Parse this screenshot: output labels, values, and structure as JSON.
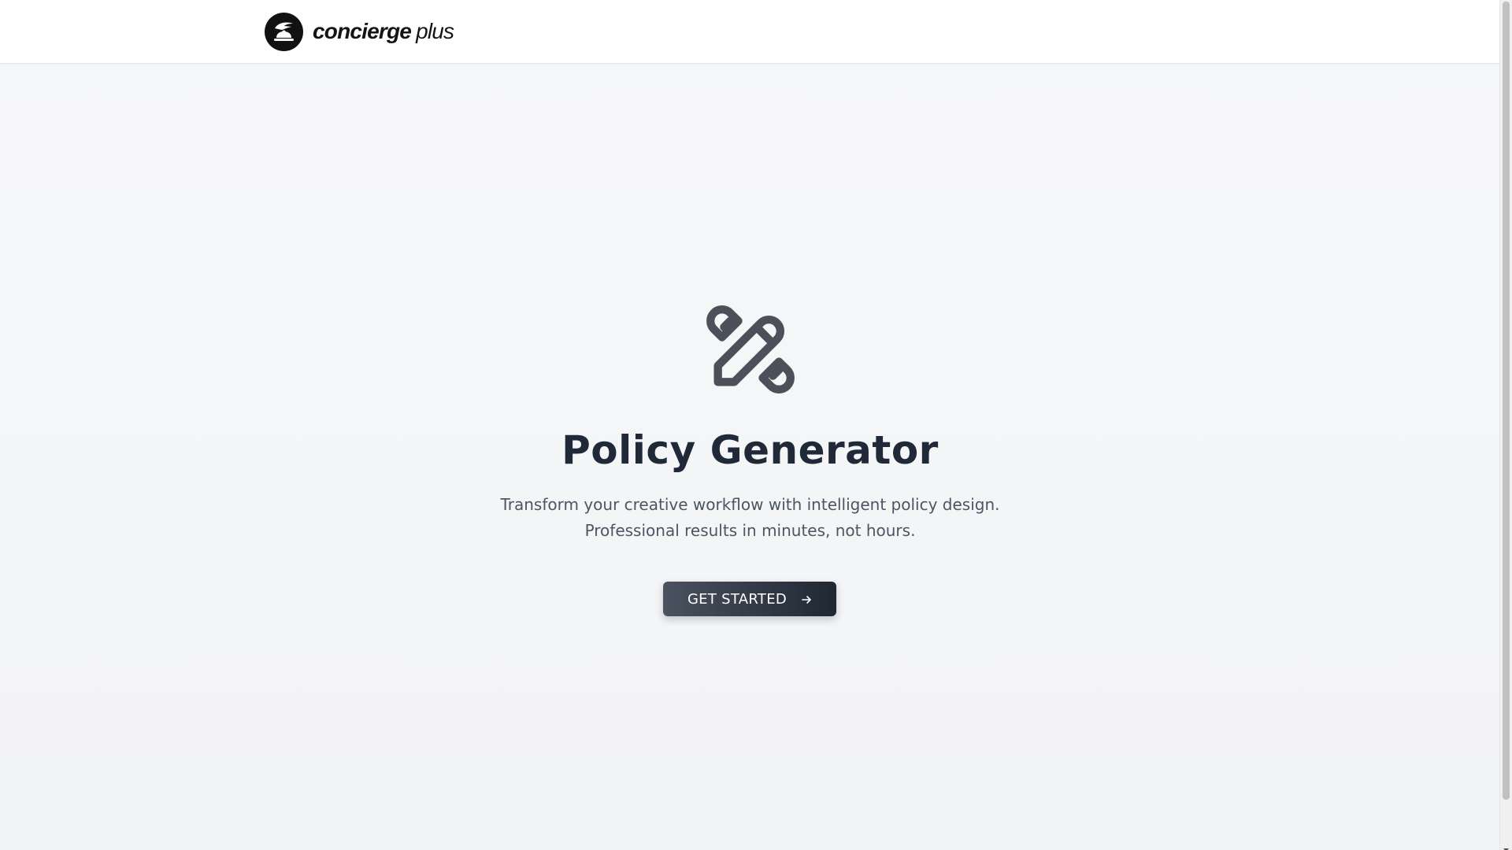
{
  "header": {
    "brand_primary": "concierge",
    "brand_secondary": "plus",
    "logo_icon": "concierge-bell-icon"
  },
  "hero": {
    "icon": "pencil-ruler-icon",
    "title": "Policy Generator",
    "subtitle_line1": "Transform your creative workflow with intelligent policy design.",
    "subtitle_line2": "Professional results in minutes, not hours.",
    "cta_label": "GET STARTED",
    "cta_icon": "arrow-right-icon"
  },
  "colors": {
    "title": "#1f2937",
    "subtitle": "#4b5563",
    "cta_start": "#4a5260",
    "cta_end": "#1f2733",
    "background": "#f5f6f8"
  }
}
